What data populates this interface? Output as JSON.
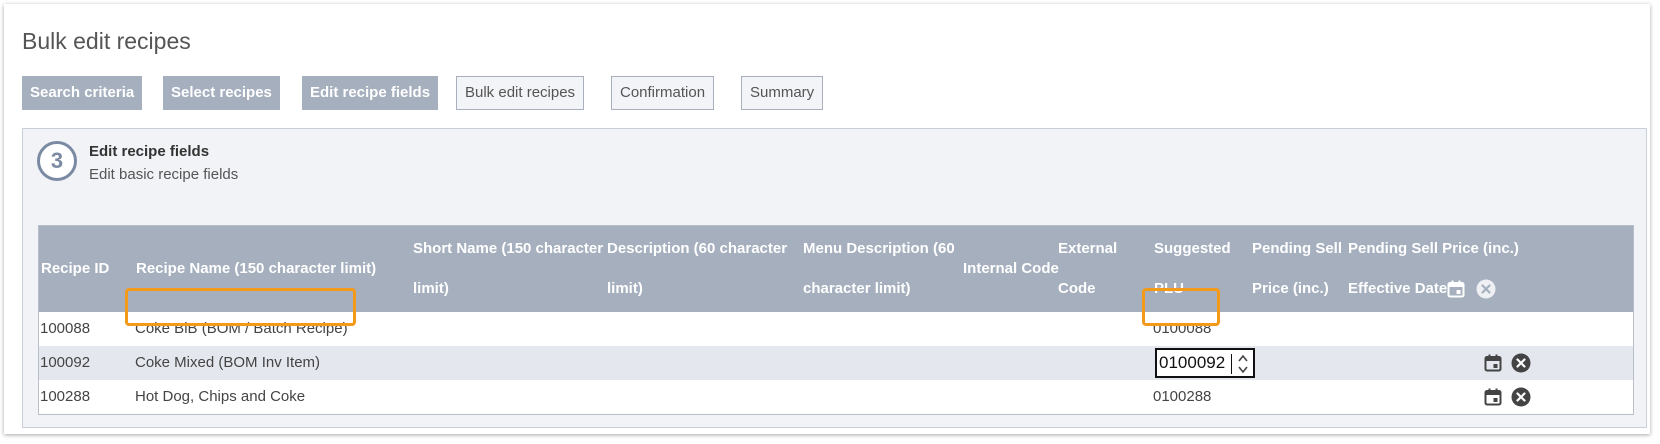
{
  "page": {
    "title": "Bulk edit recipes"
  },
  "steps": [
    {
      "label": "Search criteria",
      "state": "done"
    },
    {
      "label": "Select recipes",
      "state": "done"
    },
    {
      "label": "Edit recipe fields",
      "state": "done"
    },
    {
      "label": "Bulk edit recipes",
      "state": "todo"
    },
    {
      "label": "Confirmation",
      "state": "todo"
    },
    {
      "label": "Summary",
      "state": "todo"
    }
  ],
  "section": {
    "number": "3",
    "title": "Edit recipe fields",
    "subtitle": "Edit basic recipe fields"
  },
  "table": {
    "headers": {
      "recipe_id": "Recipe ID",
      "recipe_name": "Recipe Name (150 character limit)",
      "short_name_1": "Short Name (150 character",
      "short_name_2": "limit)",
      "description_1": "Description (60 character",
      "description_2": "limit)",
      "menu_desc_1": "Menu Description (60",
      "menu_desc_2": "character limit)",
      "internal_code": "Internal Code",
      "external_1": "External",
      "external_2": "Code",
      "plu_1": "Suggested",
      "plu_2": "PLU",
      "pending_1": "Pending Sell",
      "pending_2": "Price (inc.)",
      "effective_1": "Pending Sell Price (inc.)",
      "effective_2": "Effective Date"
    },
    "rows": [
      {
        "id": "100088",
        "name": "Coke BiB (BOM / Batch Recipe)",
        "plu": "0100088"
      },
      {
        "id": "100092",
        "name": "Coke Mixed (BOM Inv Item)",
        "plu": "0100092"
      },
      {
        "id": "100288",
        "name": "Hot Dog, Chips and Coke",
        "plu": "0100288"
      }
    ]
  },
  "colors": {
    "header_bg": "#a5afbe",
    "highlight": "#f39a1a",
    "step_done": "#a5afbe"
  },
  "icons": {
    "calendar": "calendar-icon",
    "clear": "clear-circle-icon",
    "spinner": "number-spinner-icon"
  }
}
